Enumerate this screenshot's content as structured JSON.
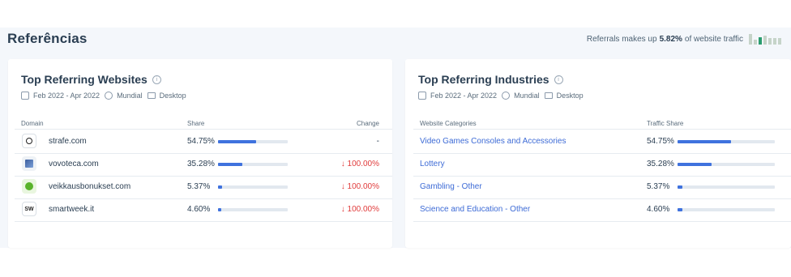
{
  "section": {
    "title": "Referências",
    "summary_prefix": "Referrals makes up",
    "summary_value": "5.82%",
    "summary_suffix": "of website traffic"
  },
  "websites_card": {
    "title": "Top Referring Websites",
    "date_range": "Feb 2022 - Apr 2022",
    "region": "Mundial",
    "device": "Desktop",
    "columns": {
      "domain": "Domain",
      "share": "Share",
      "change": "Change"
    },
    "rows": [
      {
        "favicon": "target-icon",
        "domain": "strafe.com",
        "share": "54.75%",
        "share_value": 54.75,
        "change": "-",
        "change_dir": "neutral"
      },
      {
        "favicon": "vovoteca-icon",
        "domain": "vovoteca.com",
        "share": "35.28%",
        "share_value": 35.28,
        "change": "↓ 100.00%",
        "change_dir": "neg"
      },
      {
        "favicon": "veikkaus-icon",
        "domain": "veikkausbonukset.com",
        "share": "5.37%",
        "share_value": 5.37,
        "change": "↓ 100.00%",
        "change_dir": "neg"
      },
      {
        "favicon": "sw-icon",
        "favicon_text": "SW",
        "domain": "smartweek.it",
        "share": "4.60%",
        "share_value": 4.6,
        "change": "↓ 100.00%",
        "change_dir": "neg"
      }
    ]
  },
  "industries_card": {
    "title": "Top Referring Industries",
    "date_range": "Feb 2022 - Apr 2022",
    "region": "Mundial",
    "device": "Desktop",
    "columns": {
      "category": "Website Categories",
      "traffic_share": "Traffic Share"
    },
    "rows": [
      {
        "category": "Video Games Consoles and Accessories",
        "share": "54.75%",
        "share_value": 54.75
      },
      {
        "category": "Lottery",
        "share": "35.28%",
        "share_value": 35.28
      },
      {
        "category": "Gambling - Other",
        "share": "5.37%",
        "share_value": 5.37
      },
      {
        "category": "Science and Education - Other",
        "share": "4.60%",
        "share_value": 4.6
      }
    ]
  },
  "colors": {
    "accent": "#3f72de",
    "negative": "#e03b3b",
    "link": "#3d6bd6",
    "mini_bar_active": "#2a9d6f",
    "mini_bar_inactive": "#c6d4c9"
  }
}
